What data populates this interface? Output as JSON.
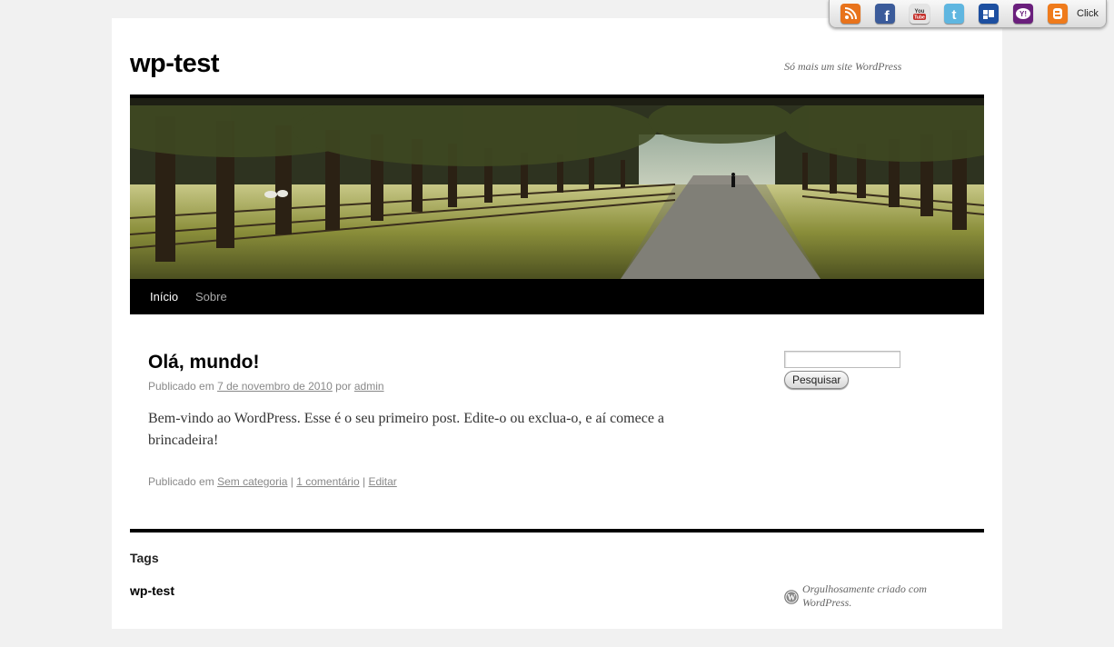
{
  "site": {
    "title": "wp-test",
    "description": "Só mais um site WordPress"
  },
  "nav": {
    "items": [
      {
        "label": "Início"
      },
      {
        "label": "Sobre"
      }
    ]
  },
  "post": {
    "title": "Olá, mundo!",
    "meta_prefix": "Publicado em",
    "date": "7 de novembro de 2010",
    "by": "por",
    "author": "admin",
    "body": "Bem-vindo ao WordPress. Esse é o seu primeiro post. Edite-o ou exclua-o, e aí comece a brincadeira!",
    "footer_prefix": "Publicado em",
    "category": "Sem categoria",
    "comments": "1 comentário",
    "edit": "Editar",
    "separator": "|"
  },
  "sidebar": {
    "search_value": "",
    "search_button": "Pesquisar"
  },
  "footer": {
    "tags_title": "Tags",
    "site_name": "wp-test",
    "powered": "Orgulhosamente criado com WordPress."
  },
  "social": {
    "icons": [
      {
        "name": "rss-icon",
        "color": "#e8731c"
      },
      {
        "name": "facebook-icon",
        "color": "#3b5b9a"
      },
      {
        "name": "youtube-icon",
        "color": "#d8d8d8"
      },
      {
        "name": "twitter-icon",
        "color": "#5fb6e0"
      },
      {
        "name": "myspace-icon",
        "color": "#1d4fa0"
      },
      {
        "name": "yahoo-icon",
        "color": "#6a1f7c"
      },
      {
        "name": "blogger-icon",
        "color": "#ef7b1c"
      }
    ],
    "click_label": "Click"
  }
}
